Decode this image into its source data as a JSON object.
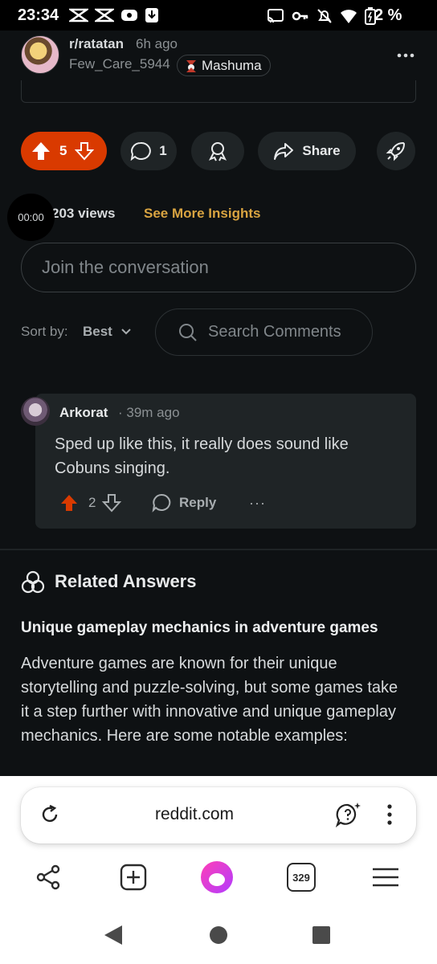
{
  "status_bar": {
    "time": "23:34",
    "battery_percent": "2 %"
  },
  "post": {
    "subreddit": "r/ratatan",
    "time_ago": "6h ago",
    "username": "Few_Care_5944",
    "flair": "Mashuma",
    "upvotes": "5",
    "comments": "1",
    "share_label": "Share",
    "views": "203 views",
    "insights_link": "See More Insights",
    "video_timer": "00:00"
  },
  "comment_box": {
    "placeholder": "Join the conversation"
  },
  "sort": {
    "label": "Sort by:",
    "value": "Best"
  },
  "search_comments": {
    "placeholder": "Search Comments"
  },
  "comment": {
    "author": "Arkorat",
    "time": "· 39m ago",
    "text": "Sped up like this, it really does sound like Cobuns singing.",
    "score": "2",
    "reply_label": "Reply",
    "more": "···"
  },
  "related": {
    "title": "Related Answers",
    "subtitle": "Unique gameplay mechanics in adventure games",
    "body": "Adventure games are known for their unique storytelling and puzzle-solving, but some games take it a step further with innovative and unique gameplay mechanics. Here are some notable examples:"
  },
  "browser": {
    "url": "reddit.com",
    "tab_count": "329"
  },
  "colors": {
    "upvote_active": "#d93a00",
    "insight_link": "#d9a441",
    "background": "#0e1113"
  }
}
